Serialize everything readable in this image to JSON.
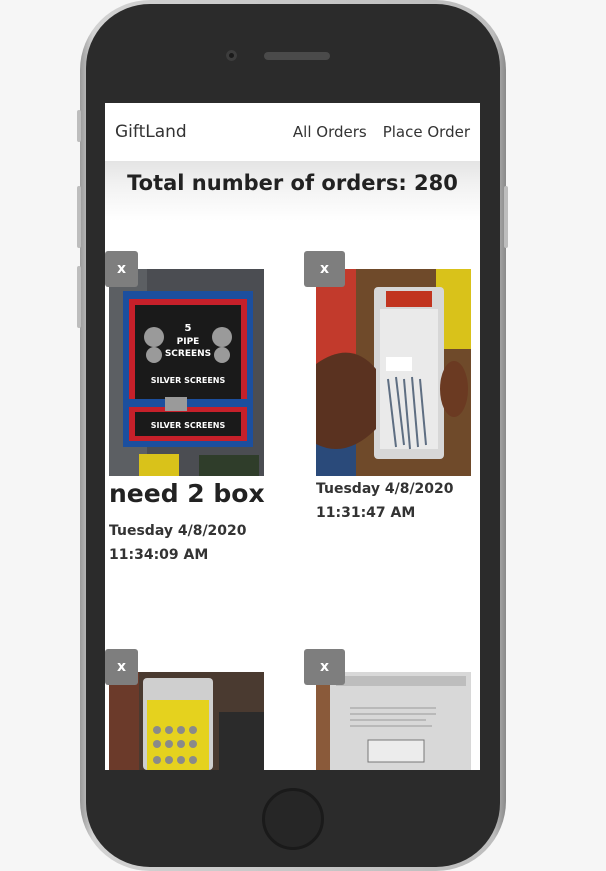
{
  "nav": {
    "brand": "GiftLand",
    "links": [
      "All Orders",
      "Place Order"
    ]
  },
  "summary": {
    "total_text": "Total number of orders: 280"
  },
  "orders": [
    {
      "remove_label": "x",
      "note": "need 2 box",
      "date_line1": "Tuesday 4/8/2020",
      "date_line2": "11:34:09 AM"
    },
    {
      "remove_label": "x",
      "note": "",
      "date_line1": "Tuesday 4/8/2020",
      "date_line2": "11:31:47 AM"
    },
    {
      "remove_label": "x",
      "note": "",
      "date_line1": "",
      "date_line2": ""
    },
    {
      "remove_label": "x",
      "note": "",
      "date_line1": "",
      "date_line2": ""
    }
  ],
  "colors": {
    "remove_button": "#7e7e7e",
    "text": "#222222"
  }
}
